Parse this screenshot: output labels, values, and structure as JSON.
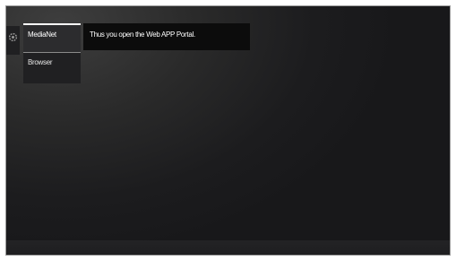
{
  "sidebar": {
    "icon": "settings-gear-icon",
    "items": [
      {
        "label": "MediaNet",
        "selected": true
      },
      {
        "label": "Browser",
        "selected": false
      }
    ]
  },
  "tooltip": {
    "text": "Thus you open the Web APP Portal."
  },
  "colors": {
    "background": "#1c1c1e",
    "menu_item": "#202022",
    "menu_item_selected": "#2c2c2e",
    "tooltip_bg": "#0c0c0c",
    "text": "#ffffff"
  }
}
